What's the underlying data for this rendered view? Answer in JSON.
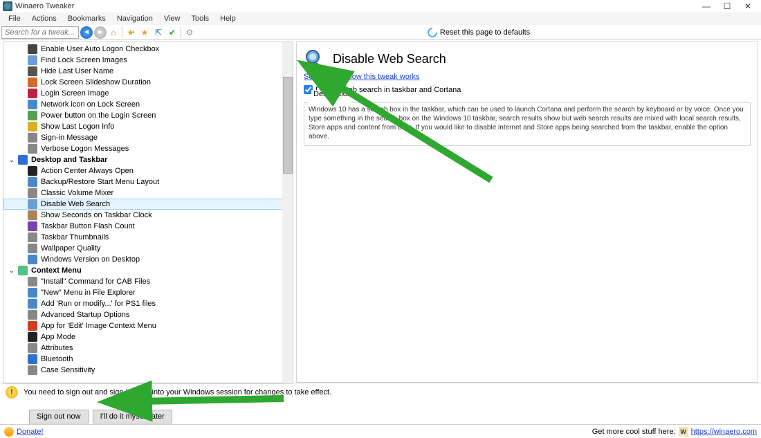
{
  "window": {
    "title": "Winaero Tweaker"
  },
  "menu": [
    "File",
    "Actions",
    "Bookmarks",
    "Navigation",
    "View",
    "Tools",
    "Help"
  ],
  "search": {
    "placeholder": "Search for a tweak..."
  },
  "toolbar": {
    "reset": "Reset this page to defaults"
  },
  "tree": {
    "items_a": [
      {
        "label": "Enable User Auto Logon Checkbox",
        "iconColor": "#444"
      },
      {
        "label": "Find Lock Screen Images",
        "iconColor": "#6b9ed4"
      },
      {
        "label": "Hide Last User Name",
        "iconColor": "#555"
      },
      {
        "label": "Lock Screen Slideshow Duration",
        "iconColor": "#d66b2b"
      },
      {
        "label": "Login Screen Image",
        "iconColor": "#c02040"
      },
      {
        "label": "Network icon on Lock Screen",
        "iconColor": "#4a88c8"
      },
      {
        "label": "Power button on the Login Screen",
        "iconColor": "#55a055"
      },
      {
        "label": "Show Last Logon Info",
        "iconColor": "#d8b020"
      },
      {
        "label": "Sign-in Message",
        "iconColor": "#888"
      },
      {
        "label": "Verbose Logon Messages",
        "iconColor": "#888"
      }
    ],
    "group_b": "Desktop and Taskbar",
    "items_b": [
      {
        "label": "Action Center Always Open",
        "iconColor": "#222"
      },
      {
        "label": "Backup/Restore Start Menu Layout",
        "iconColor": "#4a88c8"
      },
      {
        "label": "Classic Volume Mixer",
        "iconColor": "#888"
      },
      {
        "label": "Disable Web Search",
        "iconColor": "#6b9ed4",
        "selected": true
      },
      {
        "label": "Show Seconds on Taskbar Clock",
        "iconColor": "#b08060"
      },
      {
        "label": "Taskbar Button Flash Count",
        "iconColor": "#7745aa"
      },
      {
        "label": "Taskbar Thumbnails",
        "iconColor": "#888"
      },
      {
        "label": "Wallpaper Quality",
        "iconColor": "#888"
      },
      {
        "label": "Windows Version on Desktop",
        "iconColor": "#4a88c8"
      }
    ],
    "group_c": "Context Menu",
    "items_c": [
      {
        "label": "\"Install\" Command for CAB Files",
        "iconColor": "#888"
      },
      {
        "label": "\"New\" Menu in File Explorer",
        "iconColor": "#4a88c8"
      },
      {
        "label": "Add 'Run or modify...' for PS1 files",
        "iconColor": "#4a88c8"
      },
      {
        "label": "Advanced Startup Options",
        "iconColor": "#888"
      },
      {
        "label": "App for 'Edit' Image Context Menu",
        "iconColor": "#d04020"
      },
      {
        "label": "App Mode",
        "iconColor": "#222"
      },
      {
        "label": "Attributes",
        "iconColor": "#888"
      },
      {
        "label": "Bluetooth",
        "iconColor": "#3070d0"
      },
      {
        "label": "Case Sensitivity",
        "iconColor": "#888"
      }
    ]
  },
  "content": {
    "title": "Disable Web Search",
    "detail_link": "See in detail how this tweak works",
    "checkbox_label": "Disable web search in taskbar and Cortana",
    "desc_label": "Description",
    "desc_text": "Windows 10 has a search box in the taskbar, which can be used to launch Cortana and perform the search by keyboard or by voice. Once you type something in the search box on the Windows 10 taskbar, search results show but web search results are mixed with local search results, Store apps and content from Bing. If you would like to disable internet and Store apps being searched from the taskbar, enable the option above."
  },
  "notice": {
    "text": "You need to sign out and sign in back into your Windows session for changes to take effect.",
    "sign_out": "Sign out now",
    "later": "I'll do it myself later"
  },
  "footer": {
    "donate": "Donate!",
    "more": "Get more cool stuff here:",
    "url": "https://winaero.com"
  }
}
